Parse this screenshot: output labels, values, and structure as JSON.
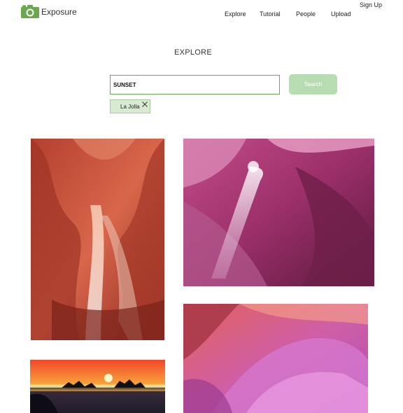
{
  "app": {
    "name": "Exposure",
    "logo_icon": "camera-icon",
    "accent": "#6aa84f"
  },
  "nav": {
    "items": [
      {
        "label": "Explore"
      },
      {
        "label": "Tutorial"
      },
      {
        "label": "People"
      },
      {
        "label": "Upload"
      }
    ],
    "signup_label": "Sign Up"
  },
  "page": {
    "title": "EXPLORE"
  },
  "search": {
    "value": "SUNSET",
    "button_label": "Search"
  },
  "filters": [
    {
      "label": "La Jolla",
      "close_icon": "close-icon"
    }
  ],
  "gallery": {
    "photo_count": 4
  }
}
